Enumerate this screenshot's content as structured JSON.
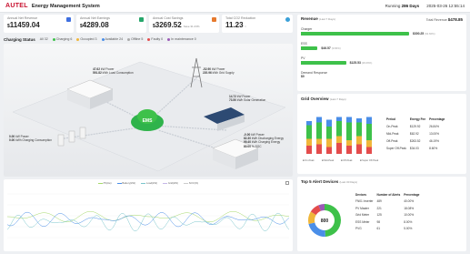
{
  "header": {
    "logo": "AUTEL",
    "title": "Energy Management System",
    "running_label": "Running",
    "running_days": "286 Days",
    "datetime": "2025-03-26 12:55:14"
  },
  "kpis": [
    {
      "label": "Annual Net Revenue",
      "prefix": "$",
      "value": "11459.04",
      "sub": "",
      "icon_color": "#3e6fe0"
    },
    {
      "label": "Annual Net Earnings",
      "prefix": "$",
      "value": "4289.08",
      "sub": "",
      "icon_color": "#26a66b"
    },
    {
      "label": "Annual Cost Savings",
      "prefix": "$",
      "value": "3269.52",
      "sub": "Save 31.23%",
      "icon_color": "#e67a2e"
    },
    {
      "label": "Total CO2 Reduction",
      "prefix": "",
      "value": "11.23",
      "sub": "t",
      "icon_color": "#3aa0d8"
    }
  ],
  "status": {
    "title": "Charging Status",
    "all": "All 32",
    "charging": "Charging 6",
    "occupied": "Occupied 3",
    "available": "Available 24",
    "offline": "Offline 5",
    "faulty": "Faulty 0",
    "maintenance": "In maintenance 0"
  },
  "scene": {
    "load": {
      "power": "47.62",
      "unit": "kW",
      "l1": "Power",
      "energy": "591.82",
      "eunit": "kWh",
      "l2": "Load Consumption"
    },
    "grid": {
      "power": "-52.90",
      "unit": "kW",
      "l1": "Power",
      "energy": "220.96",
      "eunit": "kWh",
      "l2": "Grid Supply"
    },
    "solar": {
      "power": "14.72",
      "unit": "kW",
      "l1": "Power",
      "energy": "73.50",
      "eunit": "kWh",
      "l2": "Solar Generation"
    },
    "charging": {
      "power": "0.00",
      "unit": "kW",
      "l1": "Power",
      "energy": "0.00",
      "eunit": "kWh",
      "l2": "Charging Consumption"
    },
    "storage": {
      "power": "-0.00",
      "unit": "kW",
      "l1": "Power",
      "e1": "82.30",
      "l2": "Discharging Energy",
      "e2": "99.40",
      "l3": "Charging Energy",
      "e3": "80.00",
      "l4": "SOC",
      "soc_unit": "%",
      "eunit": "kWh"
    },
    "ems_label": "EMS"
  },
  "revenue": {
    "title": "Revenue",
    "period": "(Last 7 Days)",
    "total_label": "Total Revenue",
    "total_value": "$478.85",
    "rows": [
      {
        "name": "Charger",
        "value": "$300.25",
        "pct": "(62.60%)",
        "fraction": 0.626
      },
      {
        "name": "ESS",
        "value": "$46.57",
        "pct": "(9.65%)",
        "fraction": 0.097
      },
      {
        "name": "PV",
        "value": "$125.53",
        "pct": "(26.06%)",
        "fraction": 0.261
      },
      {
        "name": "Demand Response",
        "value": "$0",
        "pct": "",
        "fraction": 0
      }
    ]
  },
  "grid": {
    "title": "Grid Overview",
    "period": "(Last 7 Days)",
    "headers": [
      "Period",
      "Energy Fee",
      "Percentage"
    ],
    "rows": [
      [
        "On-Peak",
        "$129.92",
        "26.84%"
      ],
      [
        "Mid-Peak",
        "$62.92",
        "13.00%"
      ],
      [
        "Off-Peak",
        "$263.52",
        "46.19%"
      ],
      [
        "Super Off-Peak",
        "$34.03",
        "8.60%"
      ]
    ],
    "legend": [
      "On-Peak",
      "Mid-Peak",
      "Off-Peak",
      "Super Off-Peak"
    ],
    "legend_colors": [
      "#e44c4c",
      "#f0b63a",
      "#3ec14a",
      "#4a8ee8"
    ]
  },
  "alerts": {
    "title": "Top 5 Alert Devices",
    "period": "(Last 30 Days)",
    "headers": [
      "Devices",
      "Number of Alerts",
      "Percentage"
    ],
    "rows": [
      [
        "FN01 Inverter",
        "489",
        "40.00%"
      ],
      [
        "PV Master",
        "221",
        "18.08%"
      ],
      [
        "Grid Meter",
        "125",
        "10.00%"
      ],
      [
        "ESS Meter",
        "98",
        "8.00%"
      ],
      [
        "PVG",
        "61",
        "5.00%"
      ]
    ],
    "donut_total": "800",
    "donut_colors": [
      "#3ec14a",
      "#4a8ee8",
      "#f0b63a",
      "#e44c4c",
      "#9b59b6"
    ]
  },
  "bottom_chart": {
    "legend": [
      "PV(kw)",
      "Battery(kW)",
      "Load(kW)",
      "Grid(kW)",
      "SOC(%)"
    ],
    "legend_colors": [
      "#a6d96a",
      "#4a8ee8",
      "#7bc6cc",
      "#c6b7e8",
      "#ddd"
    ]
  }
}
